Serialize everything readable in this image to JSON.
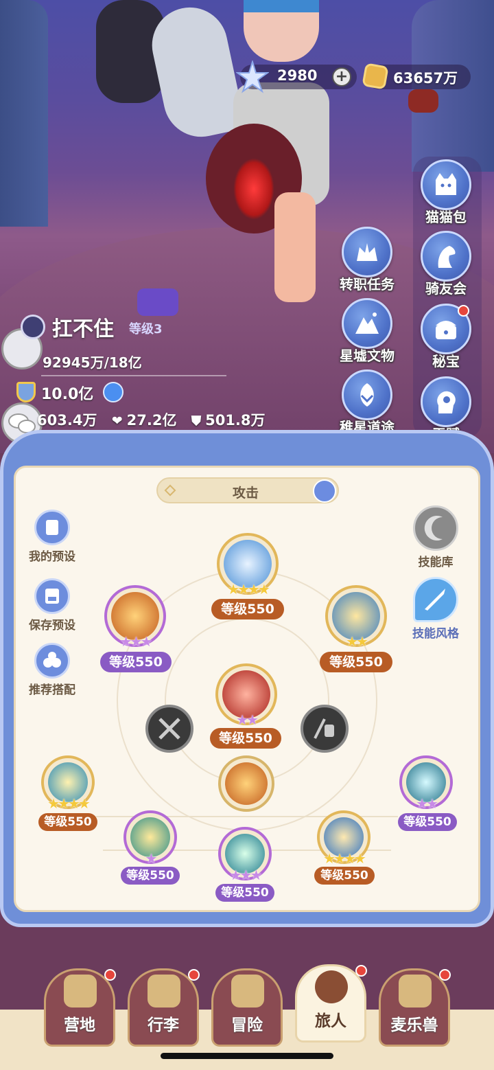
{
  "currency": {
    "gems": "2980",
    "gold": "63657万"
  },
  "right_menu": [
    {
      "label": "猫猫包",
      "icon": "cat-bag-icon",
      "badge": false
    },
    {
      "label": "骑友会",
      "icon": "horse-icon",
      "badge": false
    },
    {
      "label": "秘宝",
      "icon": "treasure-chest-icon",
      "badge": true
    },
    {
      "label": "天赋",
      "icon": "talent-head-icon",
      "badge": false
    }
  ],
  "mid_menu": [
    {
      "label": "转职任务",
      "icon": "class-change-icon"
    },
    {
      "label": "星墟文物",
      "icon": "relic-mountain-icon"
    },
    {
      "label": "稚星道途",
      "icon": "star-path-icon"
    }
  ],
  "player": {
    "name": "扛不住",
    "level": "等级3",
    "exp": "92945万/18亿",
    "power": "10.0亿",
    "attack": "603.4万",
    "hp": "27.2亿",
    "defense": "501.8万"
  },
  "panel": {
    "tab": "攻击",
    "left_buttons": [
      "我的预设",
      "保存预设",
      "推荐搭配"
    ],
    "right_buttons": [
      "技能库",
      "技能风格"
    ],
    "skills": [
      {
        "level": "等级550",
        "stars": "★★★★",
        "star_color": "y"
      },
      {
        "level": "等级550",
        "stars": "★★★",
        "star_color": "p"
      },
      {
        "level": "等级550",
        "stars": "★★",
        "star_color": "y"
      },
      {
        "level": "等级550",
        "stars": "★★",
        "star_color": "p"
      },
      {
        "level": "等级550",
        "stars": "★★★★",
        "star_color": "y"
      },
      {
        "level": "等级550",
        "stars": "★★",
        "star_color": "p"
      },
      {
        "level": "等级550",
        "stars": "★",
        "star_color": "p"
      },
      {
        "level": "等级550",
        "stars": "★★★",
        "star_color": "p"
      },
      {
        "level": "等级550",
        "stars": "★★★★",
        "star_color": "y"
      }
    ]
  },
  "nav": [
    {
      "label": "营地",
      "badge": true
    },
    {
      "label": "行李",
      "badge": true
    },
    {
      "label": "冒险",
      "badge": false
    },
    {
      "label": "旅人",
      "badge": true,
      "active": true
    },
    {
      "label": "麦乐兽",
      "badge": true
    }
  ],
  "colors": {
    "panel_blue": "#6f8fd8",
    "level_orange": "#b85c25",
    "level_purple": "#8a5bc4",
    "badge_red": "#e6463c"
  }
}
